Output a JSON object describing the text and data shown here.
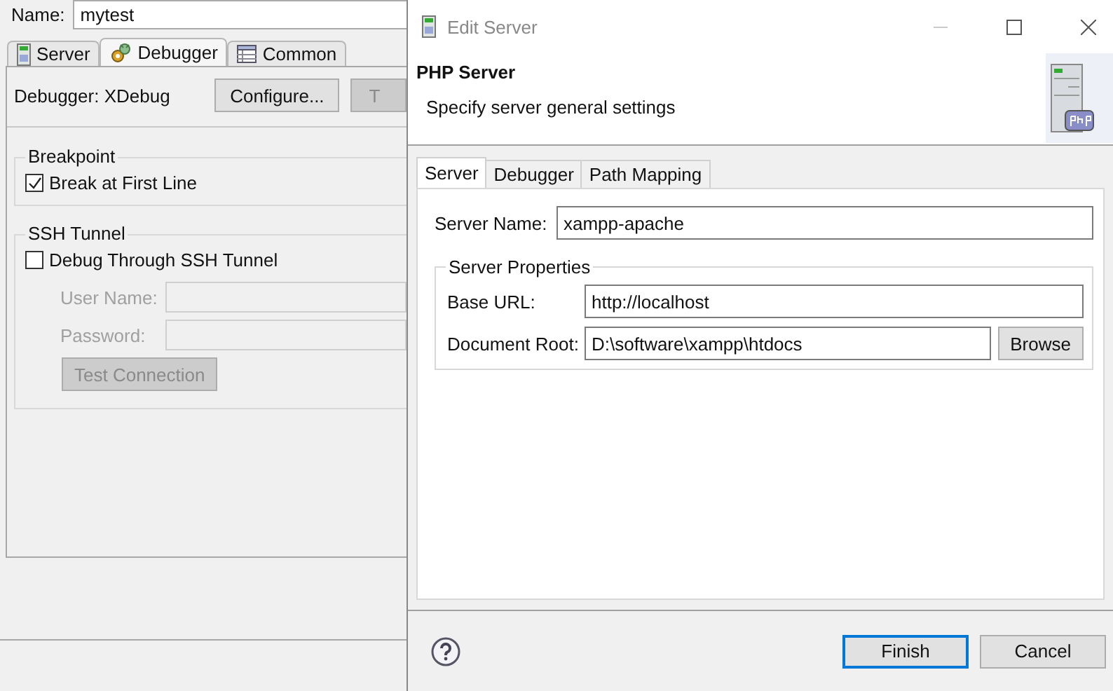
{
  "background_window": {
    "name_label": "Name:",
    "name_value": "mytest",
    "tabs": [
      {
        "label": "Server",
        "kind": "server",
        "selected": false
      },
      {
        "label": "Debugger",
        "kind": "debugger",
        "selected": true
      },
      {
        "label": "Common",
        "kind": "common",
        "selected": false
      }
    ],
    "debugger_label": "Debugger: XDebug",
    "configure_button": "Configure...",
    "cut_button": {
      "label": "T",
      "disabled": true
    },
    "breakpoint": {
      "title": "Breakpoint",
      "checkbox": {
        "label": "Break at First Line",
        "checked": true
      }
    },
    "ssh_tunnel": {
      "title": "SSH Tunnel",
      "checkbox": {
        "label": "Debug Through SSH Tunnel",
        "checked": false
      },
      "fields": [
        {
          "label": "User Name:",
          "disabled": true
        },
        {
          "label": "Password:",
          "disabled": true
        }
      ],
      "test_button": {
        "label": "Test Connection",
        "disabled": true
      }
    }
  },
  "dialog": {
    "title": "Edit Server",
    "header_title": "PHP Server",
    "header_subtitle": "Specify server general settings",
    "tabs": [
      {
        "label": "Server",
        "selected": true
      },
      {
        "label": "Debugger",
        "selected": false
      },
      {
        "label": "Path Mapping",
        "selected": false
      }
    ],
    "server_name": {
      "label": "Server Name:",
      "value": "xampp-apache"
    },
    "group_title": "Server Properties",
    "base_url": {
      "label": "Base URL:",
      "value": "http://localhost"
    },
    "document_root": {
      "label": "Document Root:",
      "value": "D:\\software\\xampp\\htdocs"
    },
    "browse_button": "Browse",
    "buttons": [
      {
        "label": "Finish",
        "default": true
      },
      {
        "label": "Cancel",
        "default": false
      }
    ]
  }
}
